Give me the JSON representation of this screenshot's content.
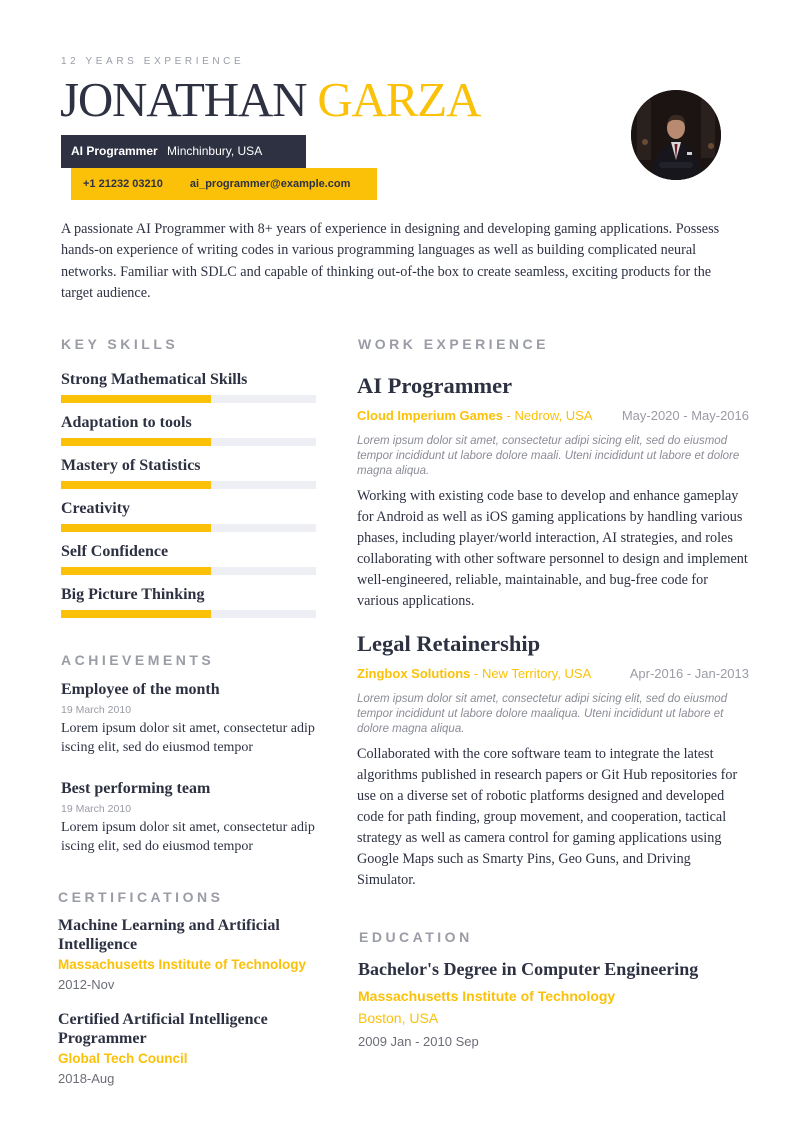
{
  "header": {
    "experience_label": "12 YEARS EXPERIENCE",
    "first_name": "JONATHAN",
    "last_name": "GARZA",
    "title": "AI Programmer",
    "location": "Minchinbury, USA",
    "phone": "+1 21232 03210",
    "email": "ai_programmer@example.com",
    "avatar_alt": "profile-photo"
  },
  "summary": "A passionate AI Programmer with 8+ years of experience in designing and developing gaming applications. Possess hands-on experience of writing codes in various programming languages as well as building complicated neural networks. Familiar with SDLC and capable of thinking out-of-the box to create seamless, exciting products for the target audience.",
  "colors": {
    "accent": "#fbc108",
    "dark": "#2d3142",
    "muted": "#9a9ca6",
    "track": "#eeeff4"
  },
  "skills": {
    "heading": "KEY SKILLS",
    "items": [
      {
        "label": "Strong Mathematical Skills",
        "level": 0.59
      },
      {
        "label": "Adaptation to tools",
        "level": 0.59
      },
      {
        "label": "Mastery of Statistics",
        "level": 0.59
      },
      {
        "label": "Creativity",
        "level": 0.59
      },
      {
        "label": "Self Confidence",
        "level": 0.59
      },
      {
        "label": "Big Picture Thinking",
        "level": 0.59
      }
    ]
  },
  "achievements": {
    "heading": "ACHIEVEMENTS",
    "items": [
      {
        "title": "Employee of the month",
        "date": "19 March 2010",
        "text": "Lorem ipsum dolor sit amet, consectetur adip iscing elit, sed do eiusmod tempor"
      },
      {
        "title": "Best performing team",
        "date": "19 March 2010",
        "text": "Lorem ipsum dolor sit amet, consectetur adip iscing elit, sed do eiusmod tempor"
      }
    ]
  },
  "certifications": {
    "heading": "CERTIFICATIONS",
    "items": [
      {
        "title": "Machine Learning and Artificial Intelligence",
        "org": "Massachusetts Institute of Technology",
        "date": "2012-Nov"
      },
      {
        "title": "Certified Artificial Intelligence Programmer",
        "org": "Global Tech Council",
        "date": "2018-Aug"
      }
    ]
  },
  "work": {
    "heading": "WORK EXPERIENCE",
    "items": [
      {
        "role": "AI Programmer",
        "company": "Cloud Imperium Games",
        "location": " - Nedrow, USA",
        "dates": "May-2020 - May-2016",
        "lorem": "Lorem ipsum dolor sit amet, consectetur adipi sicing elit, sed do eiusmod tempor incididunt ut labore dolore maali. Uteni incididunt ut labore et dolore magna aliqua.",
        "description": "Working with existing code base to develop and enhance gameplay for Android as well as iOS gaming applications by handling various phases, including player/world interaction, AI strategies, and roles collaborating with other software personnel to design and implement well-engineered, reliable, maintainable, and bug-free code for various applications."
      },
      {
        "role": "Legal Retainership",
        "company": "Zingbox Solutions",
        "location": " - New Territory, USA",
        "dates": "Apr-2016 - Jan-2013",
        "lorem": "Lorem ipsum dolor sit amet, consectetur adipi sicing elit, sed do eiusmod tempor incididunt ut labore dolore maaliqua. Uteni incididunt ut labore et dolore magna aliqua.",
        "description": "Collaborated with the core software team to integrate the latest algorithms published in research papers or Git Hub repositories for use on a diverse set of robotic platforms designed and developed code for path finding, group movement, and cooperation, tactical strategy as well as camera control for gaming applications using Google Maps such as Smarty Pins, Geo Guns, and Driving Simulator."
      }
    ]
  },
  "education": {
    "heading": "EDUCATION",
    "degree": "Bachelor's Degree in Computer Engineering",
    "school": "Massachusetts Institute of Technology",
    "location": "Boston, USA",
    "dates": "2009 Jan - 2010 Sep"
  }
}
